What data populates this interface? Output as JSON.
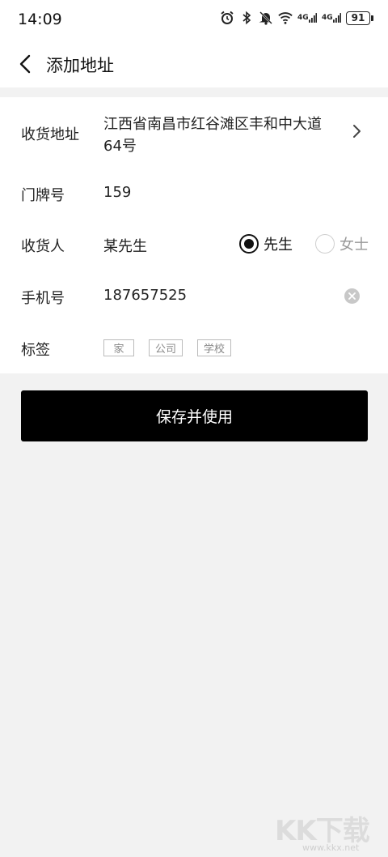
{
  "status_bar": {
    "time": "14:09",
    "icons": [
      "alarm-icon",
      "bluetooth-icon",
      "mute-icon",
      "wifi-icon",
      "signal-icon",
      "signal-icon"
    ],
    "signal_label_1": "4G",
    "signal_label_2": "4G",
    "battery": "91"
  },
  "header": {
    "title": "添加地址",
    "back_icon": "chevron-left-icon"
  },
  "form": {
    "address": {
      "label": "收货地址",
      "value": "江西省南昌市红谷滩区丰和中大道64号"
    },
    "door": {
      "label": "门牌号",
      "value": "159"
    },
    "name": {
      "label": "收货人",
      "value": "某先生",
      "options": [
        {
          "label": "先生",
          "selected": true
        },
        {
          "label": "女士",
          "selected": false
        }
      ]
    },
    "phone": {
      "label": "手机号",
      "value": "187657525"
    },
    "tags": {
      "label": "标签",
      "items": [
        "家",
        "公司",
        "学校"
      ]
    }
  },
  "actions": {
    "save_label": "保存并使用"
  },
  "watermark": {
    "logo": "KK下载",
    "url": "www.kkx.net"
  },
  "colors": {
    "primary": "#000000",
    "background": "#f2f2f2",
    "card": "#ffffff"
  }
}
